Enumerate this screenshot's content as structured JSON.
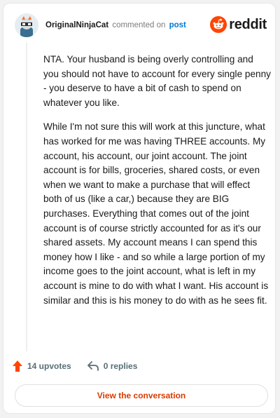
{
  "header": {
    "username": "OriginalNinjaCat",
    "action_text": "commented on",
    "post_link": "post",
    "brand_text": "reddit"
  },
  "comment": {
    "paragraphs": [
      "NTA. Your husband is being overly controlling and you should not have to account for every single penny - you deserve to have a bit of cash to spend on whatever you like.",
      "While I'm not sure this will work at this juncture, what has worked for me was having THREE accounts. My account, his account, our joint account. The joint account is for bills, groceries, shared costs, or even when we want to make a purchase that will effect both of us (like a car,) because they are BIG purchases. Everything that comes out of the joint account is of course strictly accounted for as it's our shared assets. My account means I can spend this money how I like - and so while a large portion of my income goes to the joint account, what is left in my account is mine to do with what I want. His account is similar and this is his money to do with as he sees fit."
    ]
  },
  "actions": {
    "upvotes": "14 upvotes",
    "replies": "0 replies"
  },
  "footer": {
    "view_button": "View the conversation"
  },
  "colors": {
    "brand_orange": "#ff4500",
    "link_blue": "#0079d3",
    "button_text": "#d93a00"
  },
  "icons": [
    "avatar",
    "reddit-logo-icon",
    "upvote-arrow-icon",
    "reply-arrow-icon"
  ]
}
